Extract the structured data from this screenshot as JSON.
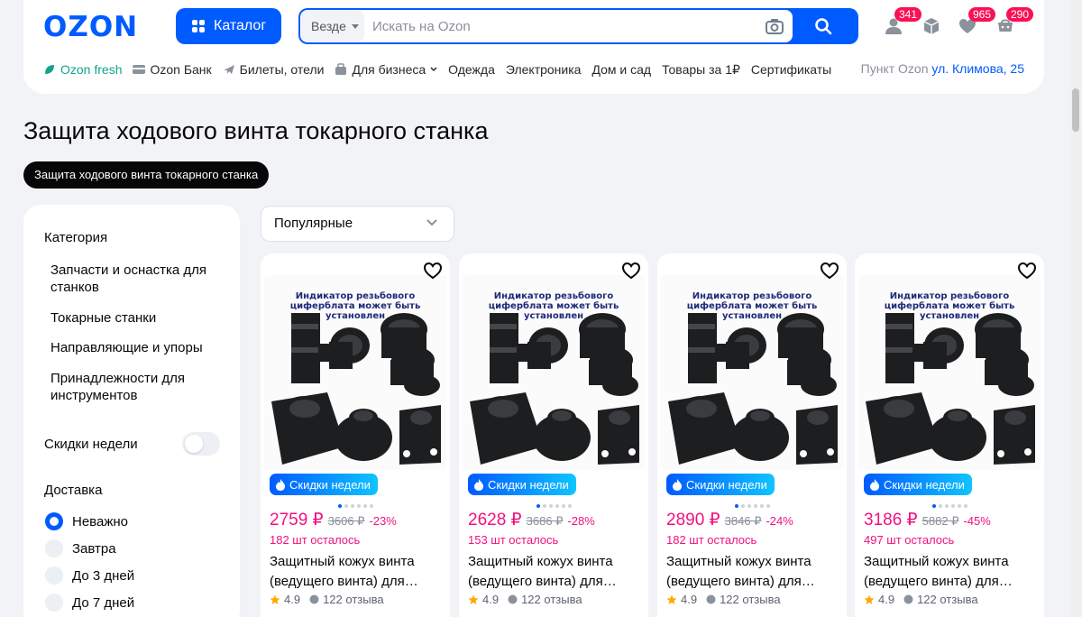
{
  "header": {
    "logo": "OZON",
    "catalog_label": "Каталог",
    "search_scope": "Везде",
    "search_placeholder": "Искать на Ozon",
    "badges": {
      "profile": "341",
      "favorites": "965",
      "cart": "290"
    },
    "accent_color": "#005bff",
    "badge_color": "#f91155"
  },
  "subnav": {
    "items": [
      {
        "label": "Ozon fresh",
        "icon": "leaf-icon"
      },
      {
        "label": "Ozon Банк",
        "icon": "card-icon"
      },
      {
        "label": "Билеты, отели",
        "icon": "plane-icon"
      },
      {
        "label": "Для бизнеса",
        "icon": "business-icon"
      },
      {
        "label": "Одежда"
      },
      {
        "label": "Электроника"
      },
      {
        "label": "Дом и сад"
      },
      {
        "label": "Товары за 1₽"
      },
      {
        "label": "Сертификаты"
      }
    ],
    "pickup_label": "Пункт Ozon",
    "pickup_address": "ул. Климова, 25"
  },
  "page": {
    "title": "Защита ходового винта токарного станка",
    "chip": "Защита ходового винта токарного станка"
  },
  "sidebar": {
    "category_heading": "Категория",
    "categories": [
      "Запчасти и оснастка для станков",
      "Токарные станки",
      "Направляющие и упоры",
      "Принадлежности для инструментов"
    ],
    "weekly_discounts_label": "Скидки недели",
    "weekly_discounts_on": false,
    "delivery_heading": "Доставка",
    "delivery_options": [
      {
        "label": "Неважно",
        "selected": true
      },
      {
        "label": "Завтра",
        "selected": false
      },
      {
        "label": "До 3 дней",
        "selected": false
      },
      {
        "label": "До 7 дней",
        "selected": false
      }
    ]
  },
  "sort": {
    "selected": "Популярные"
  },
  "products": [
    {
      "image_caption": "Индикатор резьбового циферблата может быть установлен",
      "badge": "Скидки недели",
      "price": "2759 ₽",
      "old_price": "3606 ₽",
      "discount": "-23%",
      "stock": "182 шт осталось",
      "title": "Защитный кожух винта (ведущего винта) для…",
      "rating": "4.9",
      "reviews": "122 отзыва"
    },
    {
      "image_caption": "Индикатор резьбового циферблата может быть установлен",
      "badge": "Скидки недели",
      "price": "2628 ₽",
      "old_price": "3686 ₽",
      "discount": "-28%",
      "stock": "153 шт осталось",
      "title": "Защитный кожух винта (ведущего винта) для…",
      "rating": "4.9",
      "reviews": "122 отзыва"
    },
    {
      "image_caption": "Индикатор резьбового циферблата может быть установлен",
      "badge": "Скидки недели",
      "price": "2890 ₽",
      "old_price": "3846 ₽",
      "discount": "-24%",
      "stock": "182 шт осталось",
      "title": "Защитный кожух винта (ведущего винта) для…",
      "rating": "4.9",
      "reviews": "122 отзыва"
    },
    {
      "image_caption": "Индикатор резьбового циферблата может быть установлен",
      "badge": "Скидки недели",
      "price": "3186 ₽",
      "old_price": "5882 ₽",
      "discount": "-45%",
      "stock": "497 шт осталось",
      "title": "Защитный кожух винта (ведущего винта) для…",
      "rating": "4.9",
      "reviews": "122 отзыва"
    }
  ]
}
